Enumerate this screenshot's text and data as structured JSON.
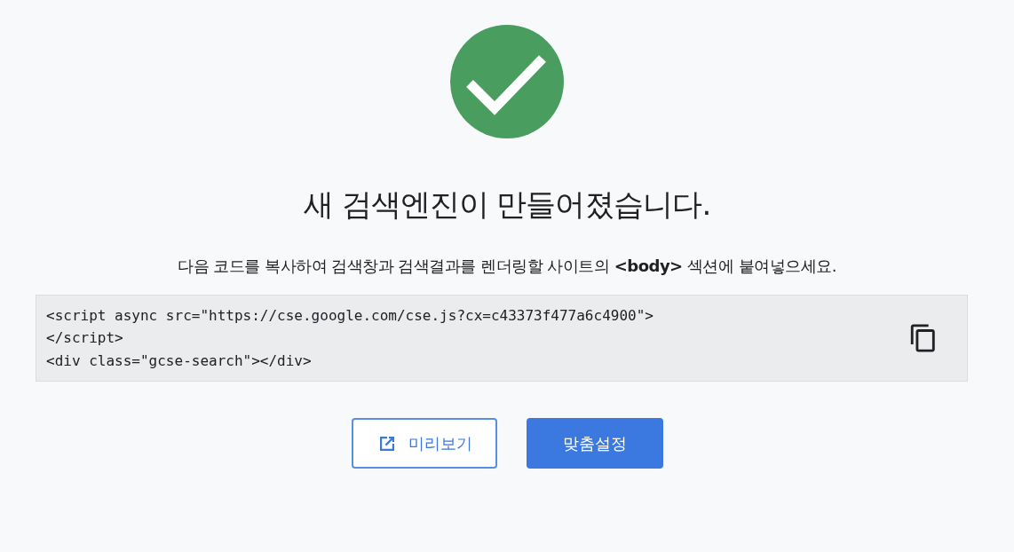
{
  "title": "새 검색엔진이 만들어졌습니다.",
  "instruction": "다음 코드를 복사하여 검색창과 검색결과를 렌더링할 사이트의 **<body>** 섹션에 붙여넣으세요.",
  "code_lines": [
    "<script async src=\"https://cse.google.com/cse.js?cx=c43373f477a6c4900\">",
    "</script>",
    "<div class=\"gcse-search\"></div>"
  ],
  "buttons": [
    {
      "label": "미리보기",
      "kind": "outline"
    },
    {
      "label": "맞춤설정",
      "kind": "primary"
    }
  ]
}
